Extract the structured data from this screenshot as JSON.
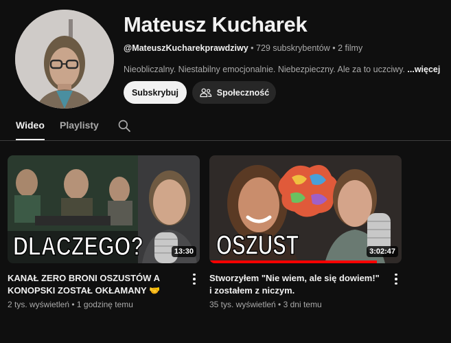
{
  "channel": {
    "name": "Mateusz Kucharek",
    "handle": "@MateuszKucharekprawdziwy",
    "subscribers": "729 subskrybentów",
    "videos_count": "2 filmy",
    "description": "Nieobliczalny. Niestabilny emocjonalnie. Niebezpieczny. Ale za to uczciwy.",
    "more_label": "...więcej",
    "subscribe_label": "Subskrybuj",
    "community_label": "Społeczność"
  },
  "tabs": [
    {
      "label": "Wideo",
      "active": true
    },
    {
      "label": "Playlisty",
      "active": false
    }
  ],
  "videos": [
    {
      "thumb_text": "DLACZEGO?",
      "duration": "13:30",
      "title": "KANAŁ ZERO BRONI OSZUSTÓW A KONOPSKI ZOSTAŁ OKŁAMANY",
      "title_emoji": "🤝",
      "views": "2 tys. wyświetleń",
      "age": "1 godzinę temu",
      "watched_fraction": 0
    },
    {
      "thumb_text": "OSZUST",
      "duration": "3:02:47",
      "title": "Stworzyłem \"Nie wiem, ale się dowiem!\" i zostałem z niczym.",
      "views": "35 tys. wyświetleń",
      "age": "3 dni temu",
      "watched_fraction": 0.87
    }
  ],
  "colors": {
    "background": "#0f0f0f",
    "progress": "#ff0000",
    "secondary_text": "#aaaaaa"
  }
}
